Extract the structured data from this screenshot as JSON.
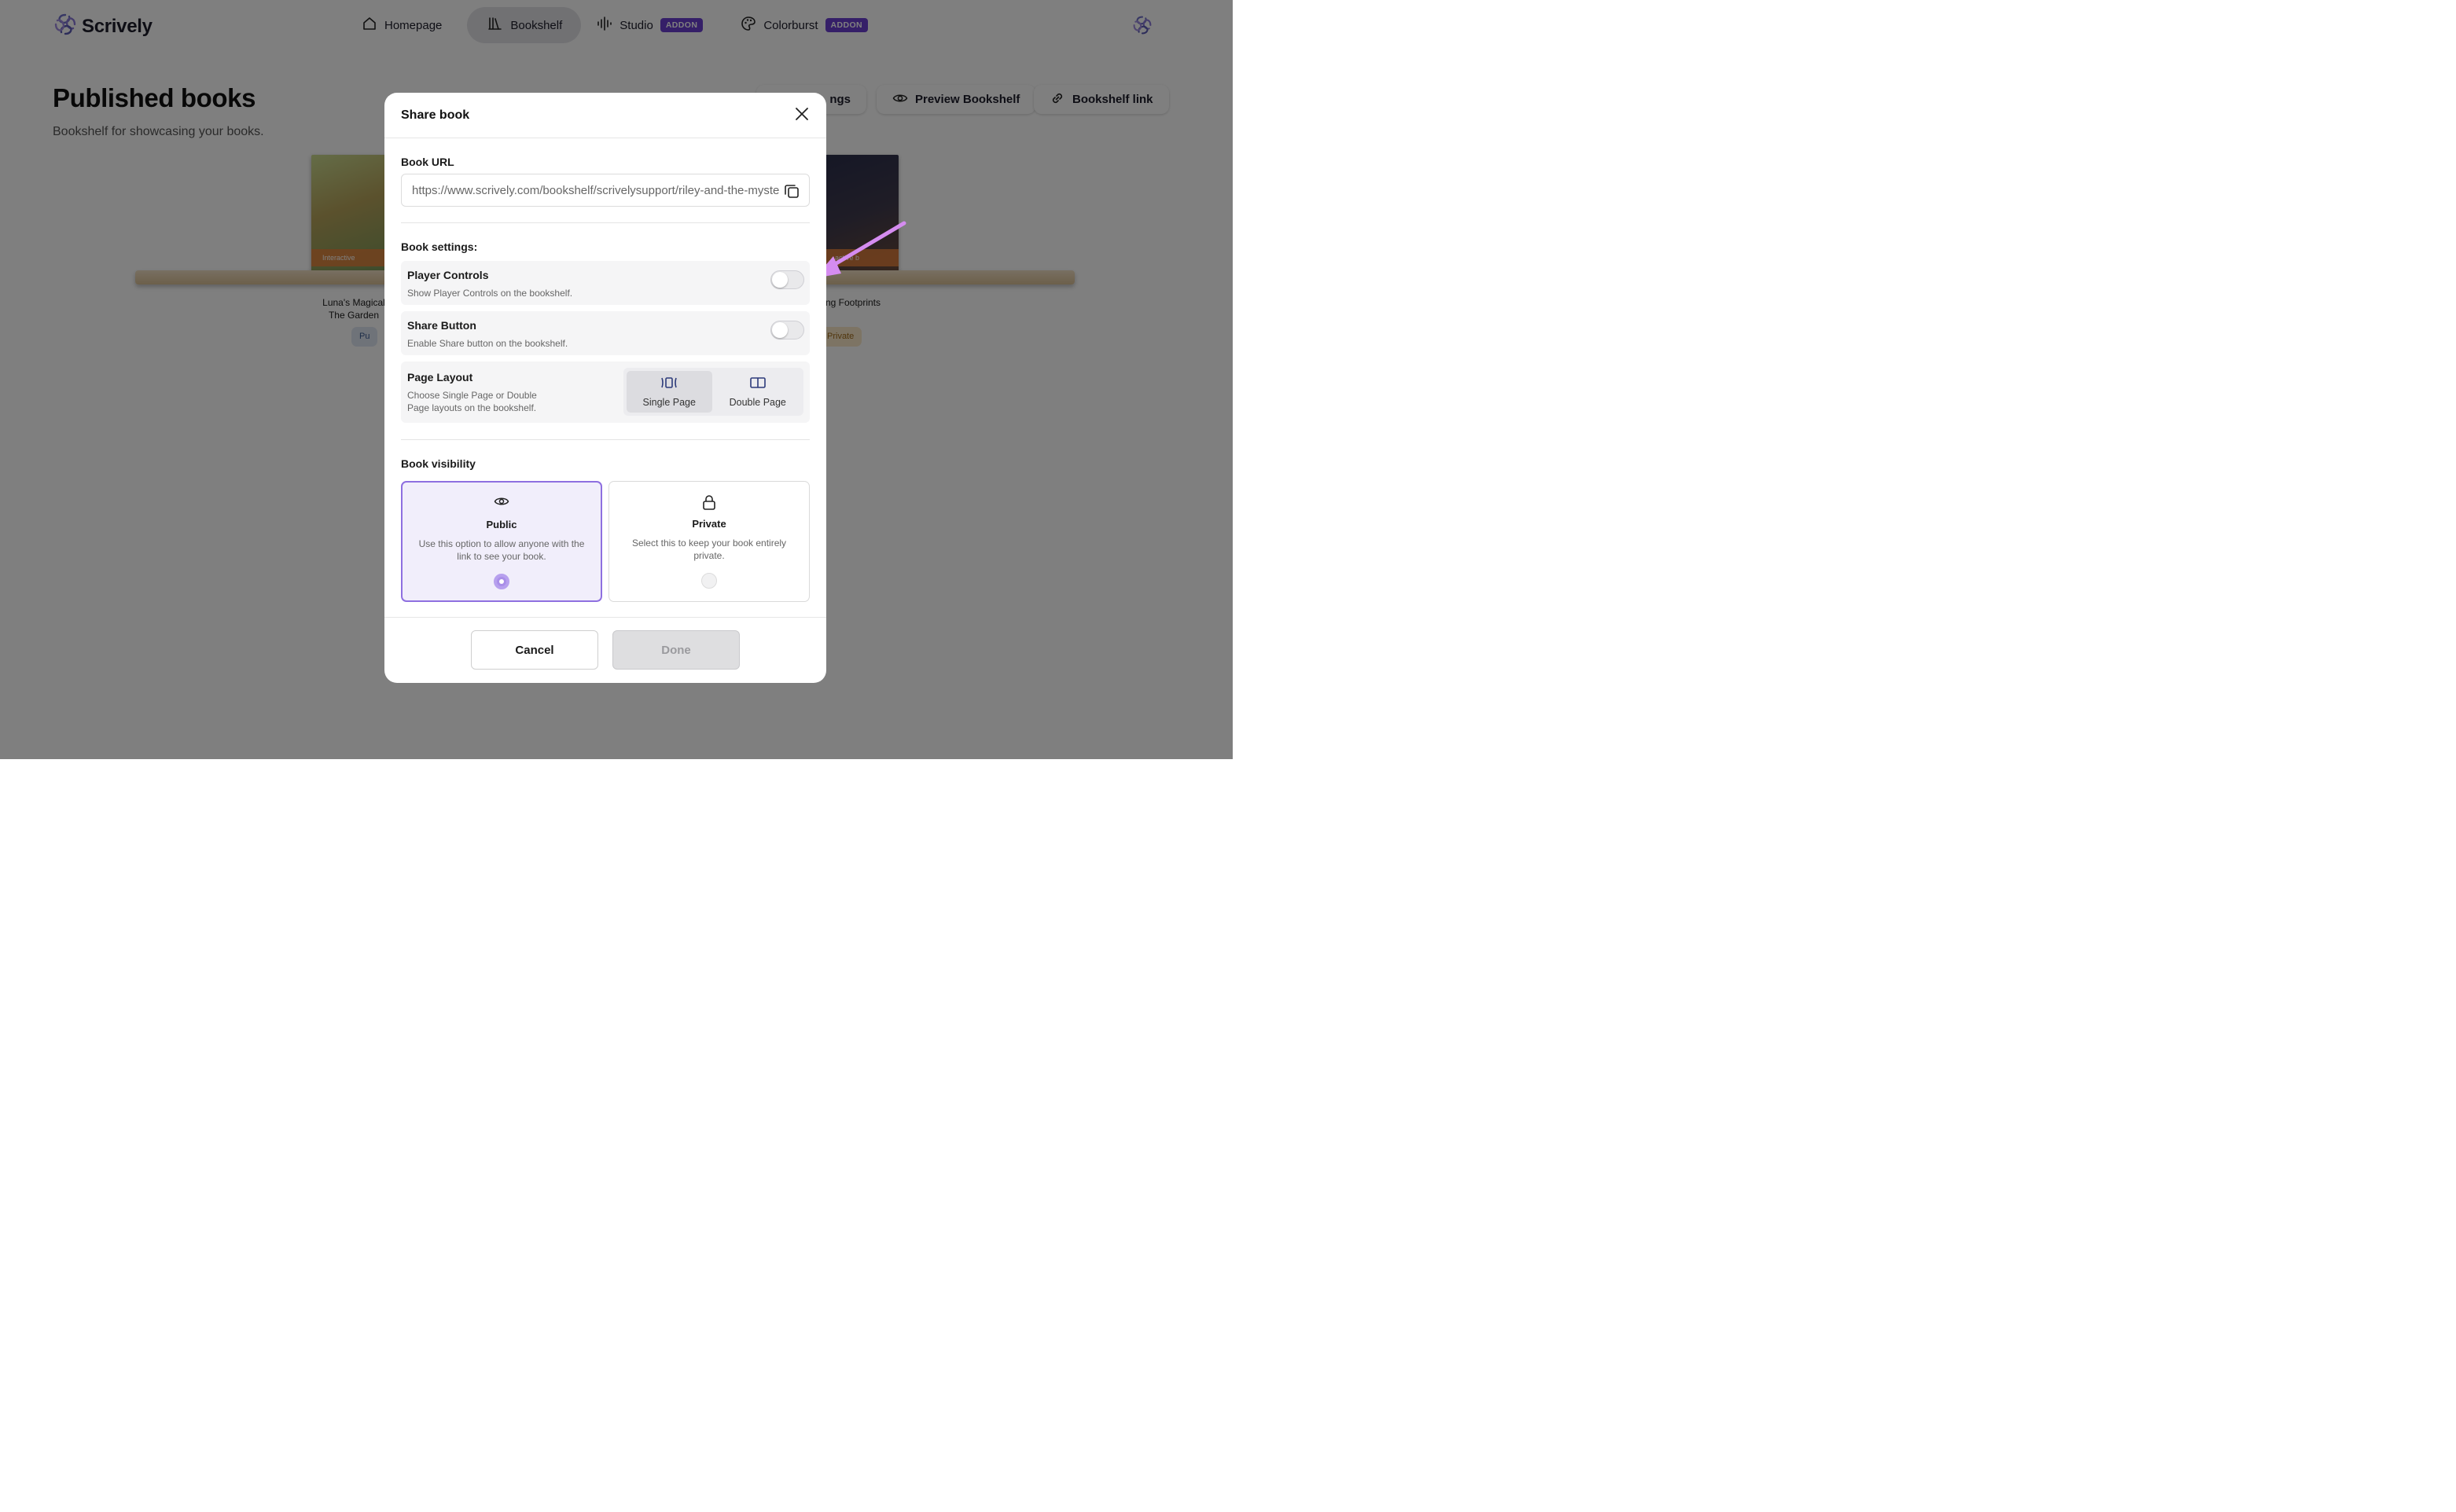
{
  "app": {
    "name": "Scrively"
  },
  "nav": {
    "items": [
      {
        "label": "Homepage",
        "icon": "home-icon",
        "active": false
      },
      {
        "label": "Bookshelf",
        "icon": "library-icon",
        "active": true
      },
      {
        "label": "Studio",
        "icon": "audio-wave-icon",
        "badge": "ADDON",
        "active": false
      },
      {
        "label": "Colorburst",
        "icon": "palette-icon",
        "badge": "ADDON",
        "active": false
      }
    ]
  },
  "page": {
    "title": "Published books",
    "subtitle": "Bookshelf for showcasing your books.",
    "actions": {
      "settings_label": "ngs",
      "preview_label": "Preview Bookshelf",
      "link_label": "Bookshelf link"
    }
  },
  "books": [
    {
      "title_line1": "Luna's Magical",
      "title_line2": "The Garden",
      "tag": "Interactive",
      "badge": "Pu"
    },
    {
      "title_line1": "ng Footprints",
      "tag": "active b",
      "badge": "Private"
    }
  ],
  "modal": {
    "title": "Share book",
    "url_label": "Book URL",
    "url_value": "https://www.scrively.com/bookshelf/scrivelysupport/riley-and-the-mysterious-footprints",
    "settings_label": "Book settings:",
    "player_controls": {
      "title": "Player Controls",
      "desc": "Show Player Controls on the bookshelf.",
      "enabled": false
    },
    "share_button": {
      "title": "Share Button",
      "desc": "Enable Share button on the bookshelf.",
      "enabled": false
    },
    "page_layout": {
      "title": "Page Layout",
      "desc_line1": "Choose Single Page or Double",
      "desc_line2": "Page layouts on the bookshelf.",
      "options": [
        {
          "label": "Single Page",
          "selected": true
        },
        {
          "label": "Double Page",
          "selected": false
        }
      ]
    },
    "visibility_label": "Book visibility",
    "visibility": {
      "public": {
        "title": "Public",
        "desc": "Use this option to allow anyone with the link to see your book.",
        "selected": true
      },
      "private": {
        "title": "Private",
        "desc": "Select this to keep your book entirely private.",
        "selected": false
      }
    },
    "cancel_label": "Cancel",
    "done_label": "Done"
  },
  "colors": {
    "accent": "#6b3fd1",
    "selected_border": "#8e6fe0",
    "annotation_arrow": "#d58cf0"
  }
}
